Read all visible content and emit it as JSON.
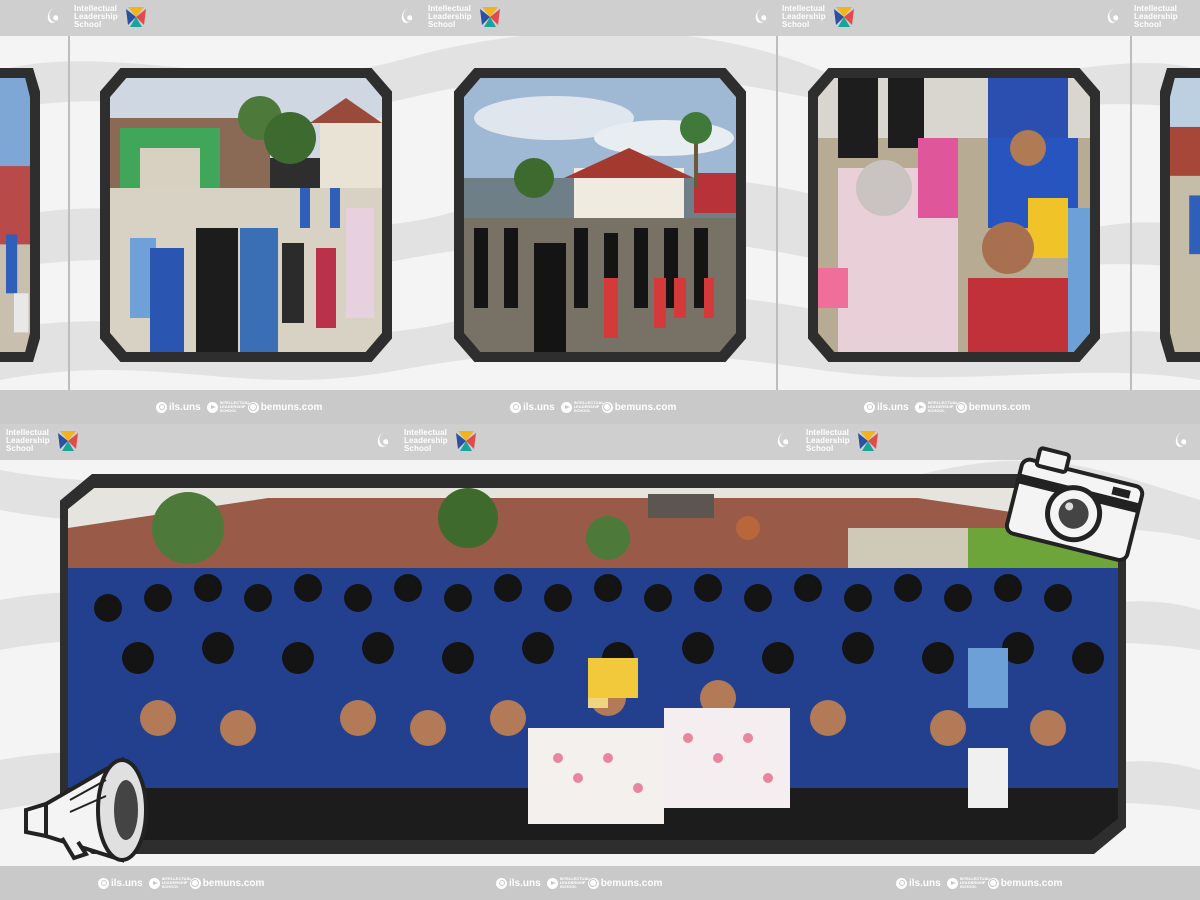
{
  "brand": {
    "line1": "Intellectual",
    "line2": "Leadership",
    "line3": "School"
  },
  "footer": {
    "instagram": "ils.uns",
    "youtube_tiny": "INTELLECTUAL LEADERSHIP SCHOOL",
    "website": "bemuns.com"
  },
  "colors": {
    "bar": "#cfcfcf",
    "frame": "#2e2e2e",
    "logo_blue": "#2b4fa2",
    "logo_teal": "#1aa39a",
    "logo_yellow": "#f2b41b",
    "logo_red": "#e14b4b"
  },
  "icons": [
    "swirl-logo-icon",
    "colorful-logo-icon",
    "instagram-icon",
    "youtube-icon",
    "globe-icon",
    "camera-icon",
    "megaphone-icon"
  ]
}
